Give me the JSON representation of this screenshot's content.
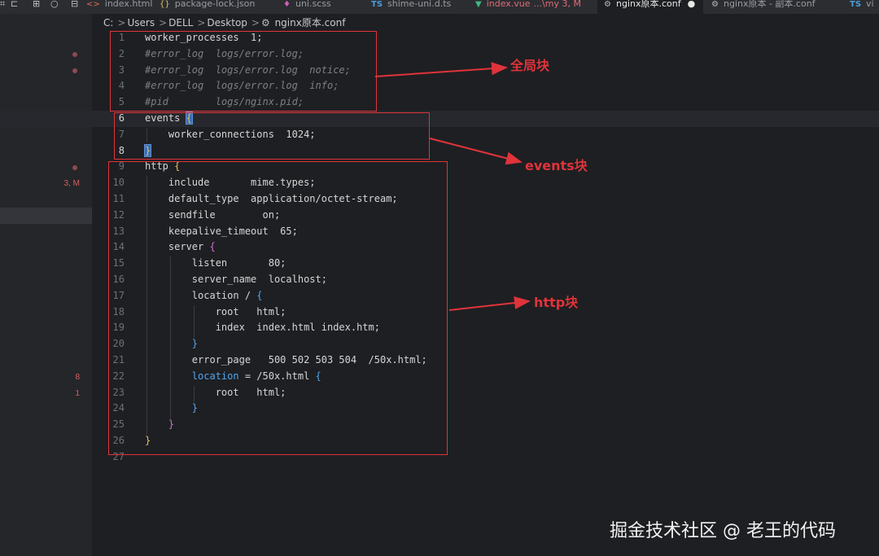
{
  "tabs": [
    {
      "icon": "html-icon",
      "glyph": "<>",
      "label": "index.html",
      "active": false
    },
    {
      "icon": "json-icon",
      "glyph": "{}",
      "label": "package-lock.json",
      "active": false
    },
    {
      "icon": "scss-icon",
      "glyph": "♦",
      "label": "uni.scss",
      "active": false
    },
    {
      "icon": "ts-icon",
      "glyph": "TS",
      "label": "shime-uni.d.ts",
      "active": false
    },
    {
      "icon": "vue-icon",
      "glyph": "▼",
      "label": "index.vue",
      "extra": "...\\my 3, M",
      "active": false
    },
    {
      "icon": "gear-icon",
      "glyph": "⚙",
      "label": "nginx原本.conf",
      "active": true,
      "dot": "●"
    },
    {
      "icon": "gear-icon",
      "glyph": "⚙",
      "label": "nginx原本 - 副本.conf",
      "active": false
    },
    {
      "icon": "ts-icon",
      "glyph": "TS",
      "label": "vi",
      "active": false
    }
  ],
  "breadcrumb": {
    "parts": [
      "C:",
      "Users",
      "DELL",
      "Desktop"
    ],
    "sep": ">",
    "file_icon": "gear-icon",
    "file": "nginx原本.conf"
  },
  "gutter": {
    "status_9": "3, M",
    "status_22": "8",
    "status_23": "1"
  },
  "lines": [
    {
      "n": "1",
      "html": "worker_processes  1;"
    },
    {
      "n": "2",
      "html": "<span class=\"cm\">#error_log  logs/error.log;</span>"
    },
    {
      "n": "3",
      "html": "<span class=\"cm\">#error_log  logs/error.log  notice;</span>"
    },
    {
      "n": "4",
      "html": "<span class=\"cm\">#error_log  logs/error.log  info;</span>"
    },
    {
      "n": "5",
      "html": "<span class=\"cm\">#pid        logs/nginx.pid;</span>"
    },
    {
      "n": "6",
      "html": "events <span class=\"br1 hl\">{</span>"
    },
    {
      "n": "7",
      "html": "    worker_connections  1024;"
    },
    {
      "n": "8",
      "html": "<span class=\"br1 hl\">}</span>"
    },
    {
      "n": "9",
      "html": "http <span class=\"br1\">{</span>"
    },
    {
      "n": "10",
      "html": "    include       mime.types;"
    },
    {
      "n": "11",
      "html": "    default_type  application/octet-stream;"
    },
    {
      "n": "12",
      "html": "    sendfile        on;"
    },
    {
      "n": "13",
      "html": "    keepalive_timeout  65;"
    },
    {
      "n": "14",
      "html": "    server <span class=\"br2\">{</span>"
    },
    {
      "n": "15",
      "html": "        listen       80;"
    },
    {
      "n": "16",
      "html": "        server_name  localhost;"
    },
    {
      "n": "17",
      "html": "        location / <span class=\"br3\">{</span>"
    },
    {
      "n": "18",
      "html": "            root   html;"
    },
    {
      "n": "19",
      "html": "            index  index.html index.htm;"
    },
    {
      "n": "20",
      "html": "        <span class=\"br3\">}</span>"
    },
    {
      "n": "21",
      "html": "        error_page   500 502 503 504  /50x.html;"
    },
    {
      "n": "22",
      "html": "        <span class=\"br3\">location</span> = /50x.html <span class=\"br3\">{</span>"
    },
    {
      "n": "23",
      "html": "            root   html;"
    },
    {
      "n": "24",
      "html": "        <span class=\"br3\">}</span>"
    },
    {
      "n": "25",
      "html": "    <span class=\"br2\">}</span>"
    },
    {
      "n": "26",
      "html": "<span class=\"br1\">}</span>"
    },
    {
      "n": "27",
      "html": ""
    }
  ],
  "annotations": {
    "global": "全局块",
    "events": "events块",
    "http": "http块"
  },
  "colors": {
    "annotation": "#e0333a",
    "background": "#1e1f22"
  },
  "watermark": "掘金技术社区 @ 老王的代码"
}
